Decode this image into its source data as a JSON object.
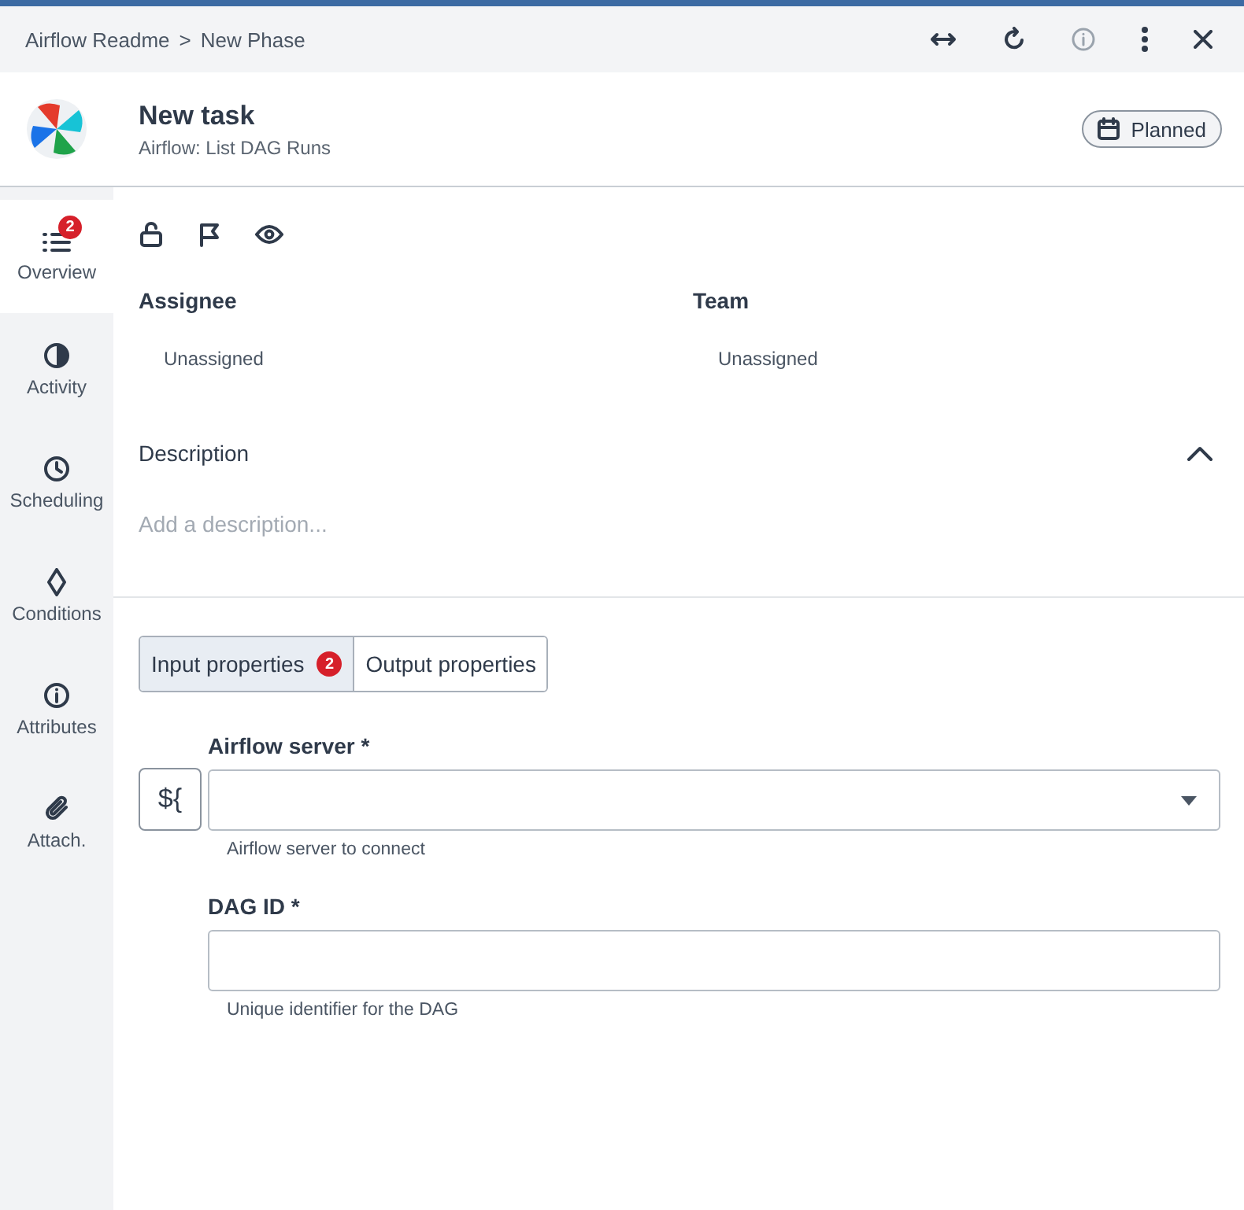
{
  "breadcrumb": {
    "items": [
      "Airflow Readme",
      "New Phase"
    ],
    "separator": ">"
  },
  "header": {
    "title": "New task",
    "subtitle": "Airflow: List DAG Runs",
    "status": "Planned"
  },
  "sidebar": {
    "items": [
      {
        "label": "Overview",
        "kind": "list",
        "selected": true,
        "badge": "2"
      },
      {
        "label": "Activity",
        "kind": "activity",
        "selected": false
      },
      {
        "label": "Scheduling",
        "kind": "clock",
        "selected": false
      },
      {
        "label": "Conditions",
        "kind": "diamond",
        "selected": false
      },
      {
        "label": "Attributes",
        "kind": "info",
        "selected": false
      },
      {
        "label": "Attach.",
        "kind": "clip",
        "selected": false
      }
    ]
  },
  "people": [
    {
      "label": "Assignee",
      "value": "Unassigned"
    },
    {
      "label": "Team",
      "value": "Unassigned"
    }
  ],
  "description": {
    "label": "Description",
    "placeholder": "Add a description...",
    "expanded": true
  },
  "tabs": [
    {
      "label": "Input properties",
      "selected": true,
      "badge": "2"
    },
    {
      "label": "Output properties",
      "selected": false
    }
  ],
  "expression_button": "${",
  "fields": [
    {
      "label": "Airflow server *",
      "kind": "select",
      "help": "Airflow server to connect"
    },
    {
      "label": "DAG ID *",
      "kind": "text",
      "help": "Unique identifier for the DAG"
    }
  ]
}
